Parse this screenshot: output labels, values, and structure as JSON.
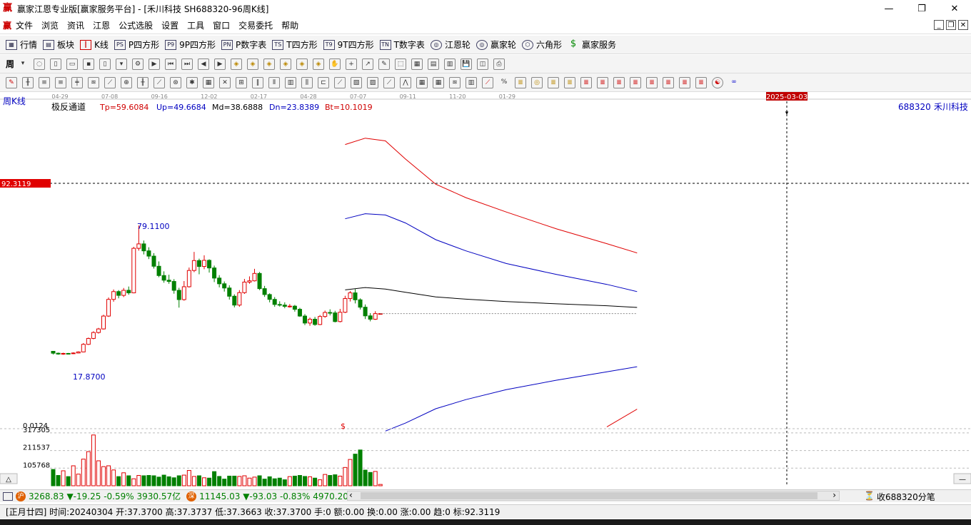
{
  "window": {
    "title": "赢家江恩专业版[赢家服务平台] - [禾川科技  SH688320-96周K线]",
    "icon": "赢"
  },
  "menu": {
    "logo": "赢",
    "items": [
      "文件",
      "浏览",
      "资讯",
      "江恩",
      "公式选股",
      "设置",
      "工具",
      "窗口",
      "交易委托",
      "帮助"
    ]
  },
  "toolbar1": {
    "items": [
      {
        "label": "行情",
        "icon": "grid-icon"
      },
      {
        "label": "板块",
        "icon": "blocks-icon"
      },
      {
        "label": "K线",
        "icon": "kline-icon"
      },
      {
        "label": "P四方形",
        "icon": "PS"
      },
      {
        "label": "9P四方形",
        "icon": "P9"
      },
      {
        "label": "P数字表",
        "icon": "PN"
      },
      {
        "label": "T四方形",
        "icon": "TS"
      },
      {
        "label": "9T四方形",
        "icon": "T9"
      },
      {
        "label": "T数字表",
        "icon": "TN"
      },
      {
        "label": "江恩轮",
        "icon": "wheel-icon"
      },
      {
        "label": "赢家轮",
        "icon": "wheel-icon"
      },
      {
        "label": "六角形",
        "icon": "hexagon-icon"
      },
      {
        "label": "赢家服务",
        "icon": "dollar-icon"
      }
    ]
  },
  "toolbar2_period": "周",
  "chart": {
    "period_label": "周K线",
    "date_ticks": [
      "04-29",
      "07-08",
      "09-16",
      "12-02",
      "02-17",
      "04-28",
      "07-07",
      "09-11",
      "11-20",
      "01-29"
    ],
    "cursor_date": "2025-03-03",
    "indicator_name": "极反通道",
    "indicators": [
      {
        "label": "Tp=59.6084",
        "color": "#d00000"
      },
      {
        "label": "Up=49.6684",
        "color": "#0000c0"
      },
      {
        "label": "Md=38.6888",
        "color": "#000000"
      },
      {
        "label": "Dn=23.8389",
        "color": "#0000c0"
      },
      {
        "label": "Bt=10.1019",
        "color": "#d00000"
      }
    ],
    "stock_code": "688320",
    "stock_name": "禾川科技",
    "price_label": "92.3119",
    "high_label": "79.1100",
    "low_label": "17.8700",
    "volume_ticks": [
      "0.0124",
      "317305",
      "211537",
      "105768"
    ],
    "volume_marker": "$",
    "scroll_up": "△",
    "scroll_left": "‹",
    "scroll_right": "›"
  },
  "chart_data": {
    "type": "candlestick",
    "candles": [
      [
        19.5,
        18.6,
        19.6,
        18.0
      ],
      [
        18.6,
        18.2,
        18.9,
        17.9
      ],
      [
        18.2,
        18.5,
        18.8,
        17.87
      ],
      [
        18.5,
        18.4,
        18.7,
        18.1
      ],
      [
        18.4,
        18.7,
        19.0,
        18.2
      ],
      [
        18.7,
        19.2,
        19.5,
        18.5
      ],
      [
        19.2,
        22.8,
        23.4,
        19.0
      ],
      [
        22.8,
        25.6,
        26.0,
        22.5
      ],
      [
        25.6,
        28.4,
        29.0,
        25.2
      ],
      [
        28.4,
        30.1,
        30.6,
        27.9
      ],
      [
        30.1,
        36.2,
        36.8,
        29.8
      ],
      [
        36.2,
        44.1,
        45.0,
        35.8
      ],
      [
        44.1,
        47.8,
        48.8,
        43.0
      ],
      [
        47.8,
        46.0,
        48.5,
        44.6
      ],
      [
        46.0,
        48.4,
        49.5,
        45.2
      ],
      [
        48.4,
        47.2,
        50.2,
        46.3
      ],
      [
        47.2,
        68.3,
        69.0,
        47.0
      ],
      [
        68.3,
        70.4,
        79.11,
        67.2
      ],
      [
        70.4,
        67.1,
        72.0,
        65.4
      ],
      [
        67.1,
        64.6,
        68.8,
        63.2
      ],
      [
        64.6,
        59.8,
        66.0,
        58.7
      ],
      [
        59.8,
        55.4,
        62.1,
        54.6
      ],
      [
        55.4,
        53.2,
        57.4,
        52.0
      ],
      [
        53.2,
        52.6,
        55.8,
        51.5
      ],
      [
        52.6,
        48.4,
        53.7,
        46.8
      ],
      [
        48.4,
        44.0,
        49.6,
        40.2
      ],
      [
        44.0,
        50.1,
        52.8,
        43.5
      ],
      [
        50.1,
        57.8,
        59.2,
        49.7
      ],
      [
        57.8,
        62.5,
        66.6,
        57.0
      ],
      [
        62.5,
        59.7,
        63.4,
        56.0
      ],
      [
        59.7,
        62.6,
        65.0,
        58.4
      ],
      [
        62.6,
        59.0,
        63.1,
        56.8
      ],
      [
        59.0,
        54.2,
        60.1,
        52.3
      ],
      [
        54.2,
        51.5,
        55.6,
        49.8
      ],
      [
        51.5,
        49.5,
        52.6,
        47.8
      ],
      [
        49.5,
        45.6,
        50.8,
        44.0
      ],
      [
        45.6,
        41.4,
        46.5,
        40.3
      ],
      [
        41.4,
        47.3,
        48.5,
        40.6
      ],
      [
        47.3,
        52.3,
        53.8,
        46.7
      ],
      [
        52.3,
        52.9,
        55.0,
        51.5
      ],
      [
        52.9,
        56.4,
        58.6,
        52.6
      ],
      [
        56.4,
        49.2,
        57.1,
        48.5
      ],
      [
        49.2,
        46.4,
        50.5,
        45.3
      ],
      [
        46.4,
        44.1,
        47.0,
        42.7
      ],
      [
        44.1,
        41.7,
        45.2,
        40.6
      ],
      [
        41.7,
        41.4,
        43.2,
        40.7
      ],
      [
        41.4,
        40.8,
        42.7,
        39.9
      ],
      [
        40.8,
        40.9,
        41.9,
        40.2
      ],
      [
        40.9,
        39.4,
        41.5,
        38.3
      ],
      [
        39.4,
        36.2,
        40.1,
        35.8
      ],
      [
        36.2,
        32.9,
        37.1,
        31.9
      ],
      [
        32.9,
        34.7,
        35.5,
        31.6
      ],
      [
        34.7,
        32.2,
        35.8,
        31.6
      ],
      [
        32.2,
        36.0,
        36.7,
        31.9
      ],
      [
        36.0,
        37.9,
        38.8,
        35.4
      ],
      [
        37.9,
        37.7,
        39.4,
        36.5
      ],
      [
        37.7,
        33.6,
        38.7,
        33.2
      ],
      [
        33.6,
        38.0,
        39.6,
        33.2
      ],
      [
        38.0,
        44.5,
        45.8,
        37.6
      ],
      [
        44.5,
        47.2,
        48.1,
        43.1
      ],
      [
        47.2,
        43.9,
        49.0,
        42.2
      ],
      [
        43.9,
        40.4,
        44.6,
        39.3
      ],
      [
        40.4,
        36.3,
        41.7,
        34.8
      ],
      [
        36.3,
        34.7,
        37.6,
        33.7
      ],
      [
        34.7,
        37.37,
        38.5,
        34.4
      ],
      [
        37.37,
        37.37,
        37.37,
        37.36
      ]
    ],
    "volumes": [
      98000,
      62000,
      90000,
      55000,
      120000,
      70000,
      160000,
      205000,
      305000,
      150000,
      115000,
      120000,
      95000,
      55000,
      78000,
      60000,
      42000,
      62000,
      60000,
      62000,
      60000,
      52000,
      64000,
      54000,
      48000,
      60000,
      64000,
      92000,
      56000,
      60000,
      48000,
      46000,
      85000,
      56000,
      40000,
      58000,
      58000,
      56000,
      60000,
      46000,
      52000,
      60000,
      40000,
      54000,
      42000,
      46000,
      36000,
      55000,
      58000,
      62000,
      56000,
      54000,
      46000,
      36000,
      68000,
      62000,
      66000,
      58000,
      110000,
      158000,
      190000,
      215000,
      94000,
      80000,
      86000,
      8000
    ],
    "channels": {
      "tp": [
        [
          58,
          117.5
        ],
        [
          62,
          120.5
        ],
        [
          66,
          119.2
        ],
        [
          70,
          110.6
        ],
        [
          76,
          98.7
        ],
        [
          82,
          92.3
        ],
        [
          90,
          85.5
        ],
        [
          100,
          77.5
        ],
        [
          110,
          70.5
        ],
        [
          116,
          66.1
        ]
      ],
      "up": [
        [
          58,
          82.3
        ],
        [
          62,
          84.7
        ],
        [
          66,
          84.1
        ],
        [
          70,
          80.3
        ],
        [
          76,
          72.4
        ],
        [
          82,
          67.1
        ],
        [
          90,
          61.1
        ],
        [
          100,
          55.9
        ],
        [
          110,
          51.2
        ],
        [
          116,
          47.8
        ]
      ],
      "md": [
        [
          58,
          48.6
        ],
        [
          62,
          49.7
        ],
        [
          66,
          49.0
        ],
        [
          70,
          47.5
        ],
        [
          76,
          45.3
        ],
        [
          82,
          44.2
        ],
        [
          90,
          43.1
        ],
        [
          100,
          42.0
        ],
        [
          110,
          41.1
        ],
        [
          116,
          40.3
        ]
      ],
      "dn": [
        [
          66,
          -18.3
        ],
        [
          70,
          -14.5
        ],
        [
          76,
          -7.7
        ],
        [
          82,
          -3.4
        ],
        [
          90,
          1.3
        ],
        [
          100,
          5.8
        ],
        [
          110,
          9.8
        ],
        [
          116,
          12.2
        ]
      ],
      "bt": [
        [
          110,
          -16.3
        ],
        [
          116,
          -7.9
        ]
      ],
      "last_close": 37.37
    },
    "price_axis": {
      "ymin": -16.5,
      "ymax": 132.9
    }
  },
  "status_bar": {
    "sh_index": "3268.83",
    "sh_change": "▼-19.25",
    "sh_pct": "-0.59%",
    "sh_amount": "3930.57亿",
    "sz_index": "11145.03",
    "sz_change": "▼-93.03",
    "sz_pct": "-0.83%",
    "sz_amount": "4970.20",
    "right_text": "收688320分笔"
  },
  "info_bar": {
    "text": "[正月廿四] 时间:20240304 开:37.3700 高:37.3737 低:37.3663 收:37.3700 手:0 额:0.00 换:0.00 涨:0.00 趋:0 标:92.3119"
  }
}
